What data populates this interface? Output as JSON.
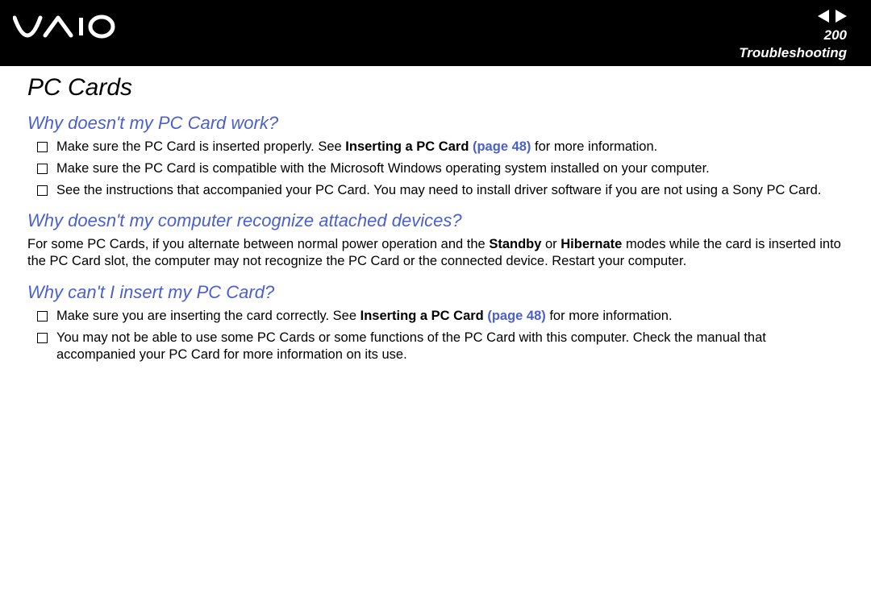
{
  "header": {
    "logo_alt": "VAIO",
    "page_number": "200",
    "section": "Troubleshooting"
  },
  "page": {
    "title": "PC Cards"
  },
  "q1": {
    "heading": "Why doesn't my PC Card work?",
    "items": {
      "a": {
        "t1": "Make sure the PC Card is inserted properly. See ",
        "bold": "Inserting a PC Card ",
        "link": "(page 48)",
        "t2": " for more information."
      },
      "b": "Make sure the PC Card is compatible with the Microsoft Windows operating system installed on your computer.",
      "c": "See the instructions that accompanied your PC Card. You may need to install driver software if you are not using a Sony PC Card."
    }
  },
  "q2": {
    "heading": "Why doesn't my computer recognize attached devices?",
    "para": {
      "t1": "For some PC Cards, if you alternate between normal power operation and the ",
      "b1": "Standby",
      "t2": " or ",
      "b2": "Hibernate",
      "t3": " modes while the card is inserted into the PC Card slot, the computer may not recognize the PC Card or the connected device. Restart your computer."
    }
  },
  "q3": {
    "heading": "Why can't I insert my PC Card?",
    "items": {
      "a": {
        "t1": "Make sure you are inserting the card correctly. See ",
        "bold": "Inserting a PC Card ",
        "link": "(page 48)",
        "t2": " for more information."
      },
      "b": "You may not be able to use some PC Cards or some functions of the PC Card with this computer. Check the manual that accompanied your PC Card for more information on its use."
    }
  }
}
